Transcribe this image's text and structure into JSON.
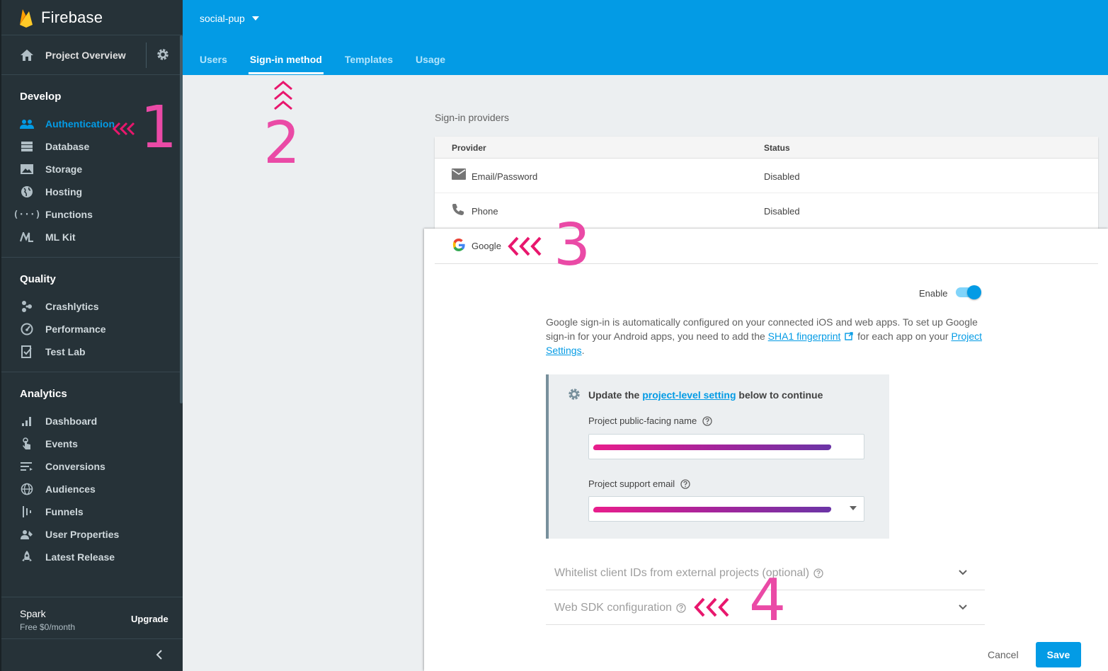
{
  "brand": {
    "name": "Firebase"
  },
  "sidebar": {
    "overview_label": "Project Overview",
    "sections": [
      {
        "title": "Develop",
        "items": [
          {
            "label": "Authentication",
            "icon": "people-icon",
            "active": true
          },
          {
            "label": "Database",
            "icon": "database-icon"
          },
          {
            "label": "Storage",
            "icon": "image-icon"
          },
          {
            "label": "Hosting",
            "icon": "globe-icon"
          },
          {
            "label": "Functions",
            "icon": "functions-icon"
          },
          {
            "label": "ML Kit",
            "icon": "mlkit-icon"
          }
        ]
      },
      {
        "title": "Quality",
        "items": [
          {
            "label": "Crashlytics",
            "icon": "crashlytics-icon"
          },
          {
            "label": "Performance",
            "icon": "gauge-icon"
          },
          {
            "label": "Test Lab",
            "icon": "checklist-icon"
          }
        ]
      },
      {
        "title": "Analytics",
        "items": [
          {
            "label": "Dashboard",
            "icon": "bar-chart-icon"
          },
          {
            "label": "Events",
            "icon": "touch-icon"
          },
          {
            "label": "Conversions",
            "icon": "filter-list-icon"
          },
          {
            "label": "Audiences",
            "icon": "globe-icon"
          },
          {
            "label": "Funnels",
            "icon": "funnel-icon"
          },
          {
            "label": "User Properties",
            "icon": "person-tag-icon"
          },
          {
            "label": "Latest Release",
            "icon": "rocket-icon"
          }
        ]
      }
    ],
    "plan": {
      "name": "Spark",
      "price": "Free $0/month",
      "upgrade_label": "Upgrade"
    }
  },
  "header": {
    "project_name": "social-pup",
    "tabs": [
      {
        "label": "Users"
      },
      {
        "label": "Sign-in method",
        "active": true
      },
      {
        "label": "Templates"
      },
      {
        "label": "Usage"
      }
    ]
  },
  "providers": {
    "section_label": "Sign-in providers",
    "columns": {
      "provider": "Provider",
      "status": "Status"
    },
    "rows": [
      {
        "name": "Email/Password",
        "status": "Disabled",
        "icon": "email-icon"
      },
      {
        "name": "Phone",
        "status": "Disabled",
        "icon": "phone-icon"
      }
    ]
  },
  "google_panel": {
    "provider_name": "Google",
    "enable_label": "Enable",
    "enabled": true,
    "desc_part1": "Google sign-in is automatically configured on your connected iOS and web apps. To set up Google sign-in for your Android apps, you need to add the ",
    "desc_link1": "SHA1 fingerprint",
    "desc_part2": " for each app on your ",
    "desc_link2": "Project Settings",
    "desc_part3": ".",
    "callout": {
      "prefix": "Update the ",
      "link": "project-level setting",
      "suffix": " below to continue",
      "public_name_label": "Project public-facing name",
      "support_email_label": "Project support email"
    },
    "expanders": [
      {
        "label": "Whitelist client IDs from external projects (optional)"
      },
      {
        "label": "Web SDK configuration"
      }
    ],
    "cancel_label": "Cancel",
    "save_label": "Save"
  },
  "annotations": [
    "1",
    "2",
    "3",
    "4"
  ],
  "colors": {
    "accent": "#039be5",
    "sidebar": "#263238",
    "annotation": "#ea4aa6"
  }
}
